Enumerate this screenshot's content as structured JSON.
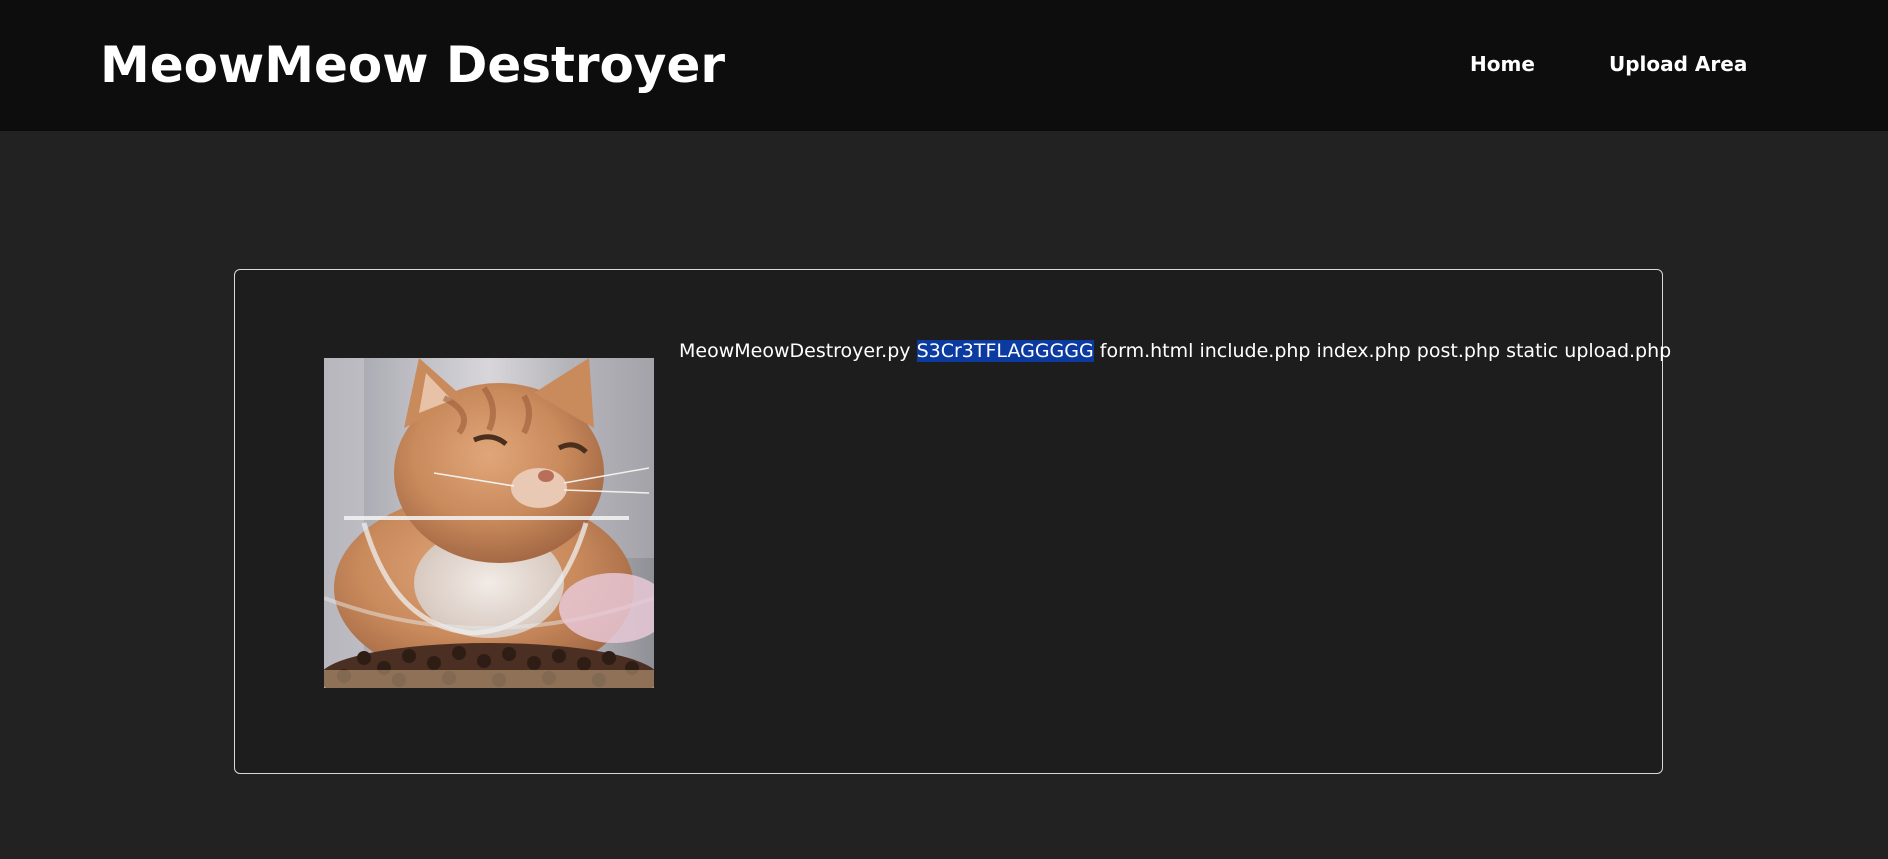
{
  "header": {
    "site_title": "MeowMeow Destroyer",
    "nav": [
      {
        "label": "Home"
      },
      {
        "label": "Upload Area"
      }
    ]
  },
  "main": {
    "image": {
      "semantic": "orange-cat-photo"
    },
    "file_listing": [
      "MeowMeowDestroyer.py",
      "S3Cr3TFLAGGGGG",
      "form.html",
      "include.php",
      "index.php",
      "post.php",
      "static",
      "upload.php"
    ],
    "highlighted_entry": "S3Cr3TFLAGGGGG"
  },
  "colors": {
    "page_background": "#222222",
    "header_background": "#0d0d0d",
    "panel_background": "#1d1d1d",
    "panel_border": "#d9d9d9",
    "text": "#ffffff",
    "selection_highlight": "#0b3aa0"
  }
}
